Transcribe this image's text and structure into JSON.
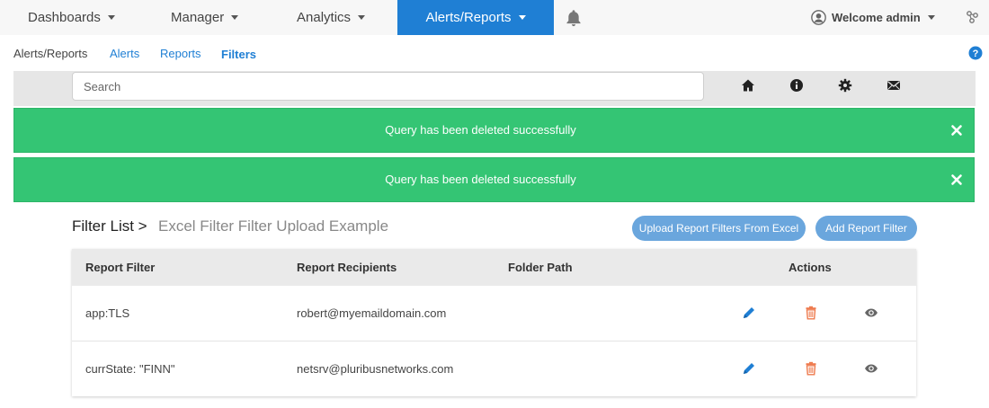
{
  "topnav": {
    "items": [
      {
        "label": "Dashboards"
      },
      {
        "label": "Manager"
      },
      {
        "label": "Analytics"
      },
      {
        "label": "Alerts/Reports"
      }
    ],
    "active_color": "#1f7fd4",
    "bell_icon": "bell-icon",
    "user": {
      "label": "Welcome admin",
      "icon": "user-circle-icon"
    },
    "network_icon": "network-icon"
  },
  "subnav": {
    "items": [
      {
        "label": "Alerts/Reports"
      },
      {
        "label": "Alerts"
      },
      {
        "label": "Reports"
      },
      {
        "label": "Filters"
      }
    ],
    "help_icon": "help-icon"
  },
  "search": {
    "placeholder": "Search",
    "value": ""
  },
  "toolbar_icons": [
    "home-icon",
    "info-icon",
    "gear-icon",
    "mail-icon"
  ],
  "alerts": [
    {
      "message": "Query has been deleted successfully"
    },
    {
      "message": "Query has been deleted successfully"
    }
  ],
  "alert_color": "#34c574",
  "filter_list": {
    "title": "Filter List >",
    "subtitle": "Excel Filter Filter Upload Example",
    "upload_button": "Upload Report Filters From Excel",
    "add_button": "Add Report Filter"
  },
  "table": {
    "columns": [
      "Report Filter",
      "Report Recipients",
      "Folder Path",
      "Actions"
    ],
    "rows": [
      {
        "filter": "app:TLS",
        "recipients": "robert@myemaildomain.com",
        "folder": ""
      },
      {
        "filter": "currState: \"FINN\"",
        "recipients": "netsrv@pluribusnetworks.com",
        "folder": ""
      }
    ],
    "action_icons": [
      "edit-icon",
      "trash-icon",
      "eye-icon"
    ],
    "edit_color": "#1f7fd4",
    "trash_color": "#ee7a4d"
  }
}
